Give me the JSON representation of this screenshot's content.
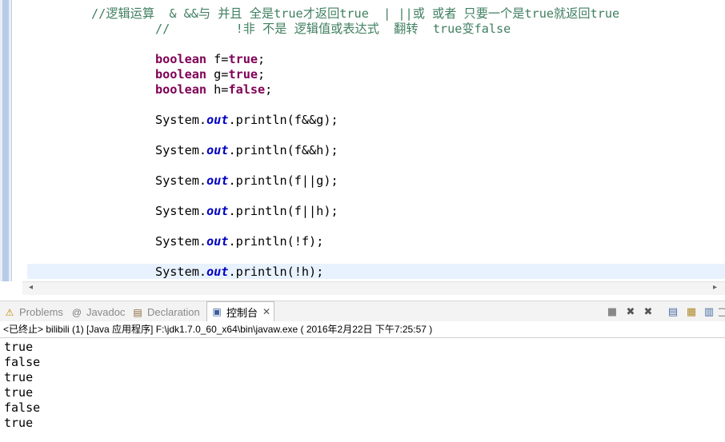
{
  "editor": {
    "comment1": "//逻辑运算  & &&与 并且 全是true才返回true  | ||或 或者 只要一个是true就返回true",
    "comment2": "//         !非 不是 逻辑值或表达式  翻转  true变false",
    "kw": "boolean",
    "decl_f": " f=",
    "decl_g": " g=",
    "decl_h": " h=",
    "val_true": "true",
    "val_false": "false",
    "semi": ";",
    "sys": "System.",
    "out": "out",
    "println_open": ".println(",
    "args": [
      "f&&g",
      "f&&h",
      "f||g",
      "f||h",
      "!f",
      "!h"
    ],
    "println_close": ");"
  },
  "scroll": {
    "left_arrow": "◂",
    "right_arrow": "▸"
  },
  "tabs": {
    "problems": "Problems",
    "javadoc": "Javadoc",
    "declaration": "Declaration",
    "console": "控制台",
    "close": "✕"
  },
  "icons": {
    "problems": "⚠",
    "javadoc": "@",
    "declaration": "▤",
    "console": "▣",
    "terminate": "■",
    "remove": "✖",
    "remove_all": "✖",
    "scroll_lock": "▤",
    "pin": "▦",
    "display": "▥",
    "open": "▢"
  },
  "status": "<已终止> bilibili (1) [Java 应用程序] F:\\jdk1.7.0_60_x64\\bin\\javaw.exe ( 2016年2月22日 下午7:25:57 )",
  "console_output": [
    "true",
    "false",
    "true",
    "true",
    "false",
    "true"
  ]
}
